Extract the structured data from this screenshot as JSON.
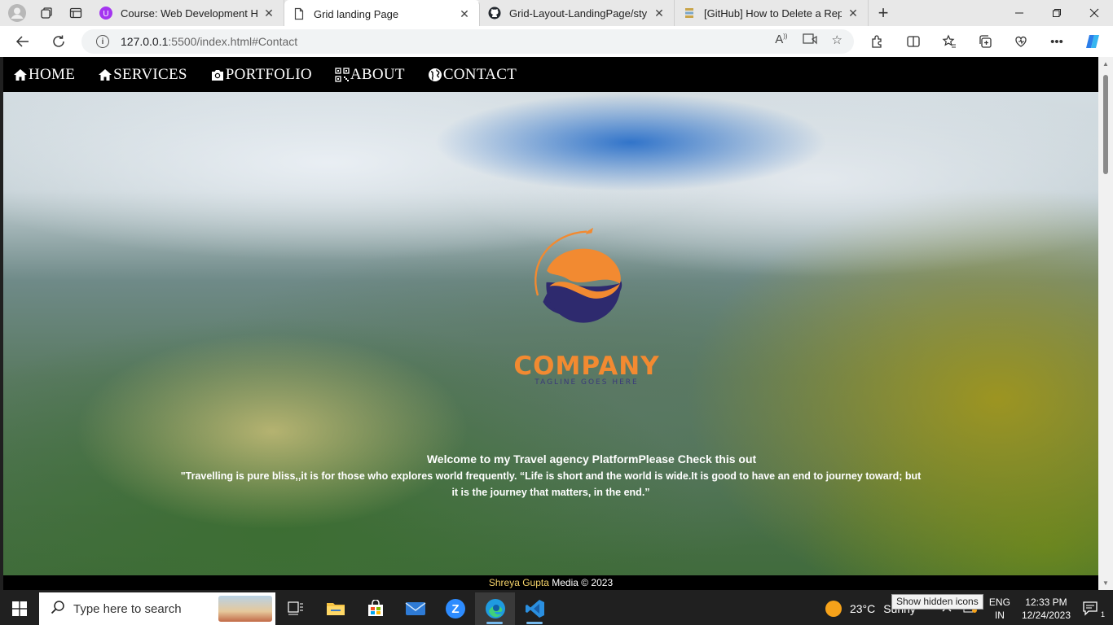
{
  "browser": {
    "tabs": [
      {
        "title": "Course: Web Development HTML",
        "close": "✕",
        "active": false
      },
      {
        "title": "Grid landing Page",
        "close": "✕",
        "active": true
      },
      {
        "title": "Grid-Layout-LandingPage/style.c",
        "close": "✕",
        "active": false
      },
      {
        "title": "[GitHub] How to Delete a Reposit",
        "close": "✕",
        "active": false
      }
    ],
    "new_tab": "+",
    "url_host": "127.0.0.1",
    "url_rest": ":5500/index.html#Contact"
  },
  "site": {
    "nav": [
      {
        "label": "HOME",
        "icon": "home-icon"
      },
      {
        "label": "SERVICES",
        "icon": "home-icon"
      },
      {
        "label": "PORTFOLIO",
        "icon": "camera-icon"
      },
      {
        "label": "ABOUT",
        "icon": "qr-code-icon"
      },
      {
        "label": "CONTACT",
        "icon": "globe-icon"
      }
    ],
    "logo": {
      "word": "COMPANY",
      "tagline": "TAGLINE GOES HERE",
      "orange": "#f28a31",
      "navy": "#2e2a6e"
    },
    "welcome": "Welcome to my  Travel agency PlatformPlease Check this out",
    "quote": "\"Travelling is pure bliss,,it is for those who explores world frequently. “Life is short and the world is wide.It is good to have an end to journey toward; but it is the journey that matters, in the end.”",
    "footer": {
      "name": "Shreya Gupta",
      "rest": " Media © 2023"
    }
  },
  "taskbar": {
    "search_placeholder": "Type here to search",
    "weather_temp": "23°C",
    "weather_desc": "Sunny",
    "lang_top": "ENG",
    "lang_bottom": "IN",
    "time": "12:33 PM",
    "date": "12/24/2023",
    "tooltip": "Show hidden icons",
    "notification_count": "1"
  }
}
